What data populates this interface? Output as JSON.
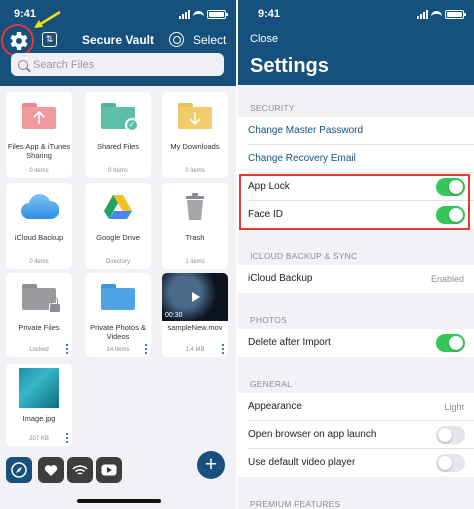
{
  "status_bar": {
    "time": "9:41"
  },
  "vault": {
    "title": "Secure Vault",
    "select_label": "Select",
    "search": {
      "placeholder": "Search Files",
      "value": ""
    },
    "tiles": [
      {
        "name": "Files App & iTunes Sharing",
        "sub": "0 items",
        "icon": "pink-upload-folder"
      },
      {
        "name": "Shared Files",
        "sub": "0 Items",
        "icon": "teal-shared-folder"
      },
      {
        "name": "My Downloads",
        "sub": "0 items",
        "icon": "yellow-download-folder"
      },
      {
        "name": "iCloud Backup",
        "sub": "0 items",
        "icon": "icloud-icon"
      },
      {
        "name": "Google Drive",
        "sub": "Directory",
        "icon": "google-drive-icon"
      },
      {
        "name": "Trash",
        "sub": "1 items",
        "icon": "trash-icon"
      },
      {
        "name": "Private Files",
        "sub": "Locked",
        "icon": "locked-folder"
      },
      {
        "name": "Private Photos & Videos",
        "sub": "14 Items",
        "icon": "blue-folder"
      },
      {
        "name": "sampleNew.mov",
        "sub": "1.4 MB",
        "duration": "00:30",
        "icon": "video-thumbnail"
      },
      {
        "name": "Image.jpg",
        "sub": "207 KB",
        "icon": "image-thumbnail"
      }
    ],
    "tabbar": [
      "compass-icon",
      "heart-icon",
      "wifi-share-icon",
      "youtube-icon"
    ],
    "add_label": "+"
  },
  "settings": {
    "close_label": "Close",
    "title": "Settings",
    "sections": [
      {
        "header": "SECURITY",
        "rows": [
          {
            "label": "Change Master Password",
            "kind": "link"
          },
          {
            "label": "Change Recovery Email",
            "kind": "link"
          },
          {
            "label": "App Lock",
            "kind": "toggle",
            "on": true
          },
          {
            "label": "Face ID",
            "kind": "toggle",
            "on": true
          }
        ]
      },
      {
        "header": "ICLOUD BACKUP & SYNC",
        "rows": [
          {
            "label": "iCloud Backup",
            "kind": "value",
            "value": "Enabled"
          }
        ]
      },
      {
        "header": "PHOTOS",
        "rows": [
          {
            "label": "Delete after Import",
            "kind": "toggle",
            "on": true
          }
        ]
      },
      {
        "header": "GENERAL",
        "rows": [
          {
            "label": "Appearance",
            "kind": "value",
            "value": "Light"
          },
          {
            "label": "Open browser on app launch",
            "kind": "toggle",
            "on": false
          },
          {
            "label": "Use default video player",
            "kind": "toggle",
            "on": false
          }
        ]
      },
      {
        "header": "PREMIUM FEATURES",
        "rows": []
      }
    ]
  },
  "colors": {
    "brand": "#16507d",
    "toggle_on": "#34c759",
    "annotation_red": "#e53935",
    "annotation_yellow": "#f2e200"
  }
}
